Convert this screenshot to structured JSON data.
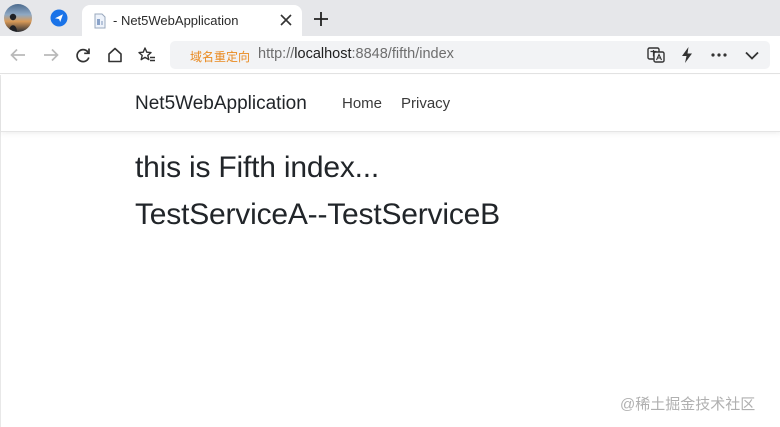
{
  "browser": {
    "tab": {
      "title": "- Net5WebApplication"
    },
    "address_bar": {
      "tag": "域名重定向",
      "url_prefix": "http://",
      "url_host": "localhost",
      "url_rest": ":8848/fifth/index"
    },
    "icons": {
      "profile": "profile-avatar",
      "pinned_tab": "paper-plane-icon",
      "tab_favicon": "page-icon",
      "tab_close": "close-icon",
      "new_tab": "plus-icon",
      "back": "back-arrow-icon",
      "forward": "forward-arrow-icon",
      "reload": "reload-icon",
      "home": "home-icon",
      "favorites": "star-list-icon",
      "translate": "translate-icon",
      "lightning": "lightning-icon",
      "more": "more-icon",
      "menu": "chevron-down-icon"
    }
  },
  "page": {
    "brand": "Net5WebApplication",
    "nav_links": [
      "Home",
      "Privacy"
    ],
    "heading_line1": "this is Fifth index...",
    "heading_line2": "TestServiceA--TestServiceB"
  },
  "watermark": "@稀土掘金技术社区",
  "colors": {
    "tab_strip": "#e6e7ea",
    "address_tag": "#e98a20",
    "pinned_icon": "#1a73e8",
    "text_dark": "#212529"
  }
}
